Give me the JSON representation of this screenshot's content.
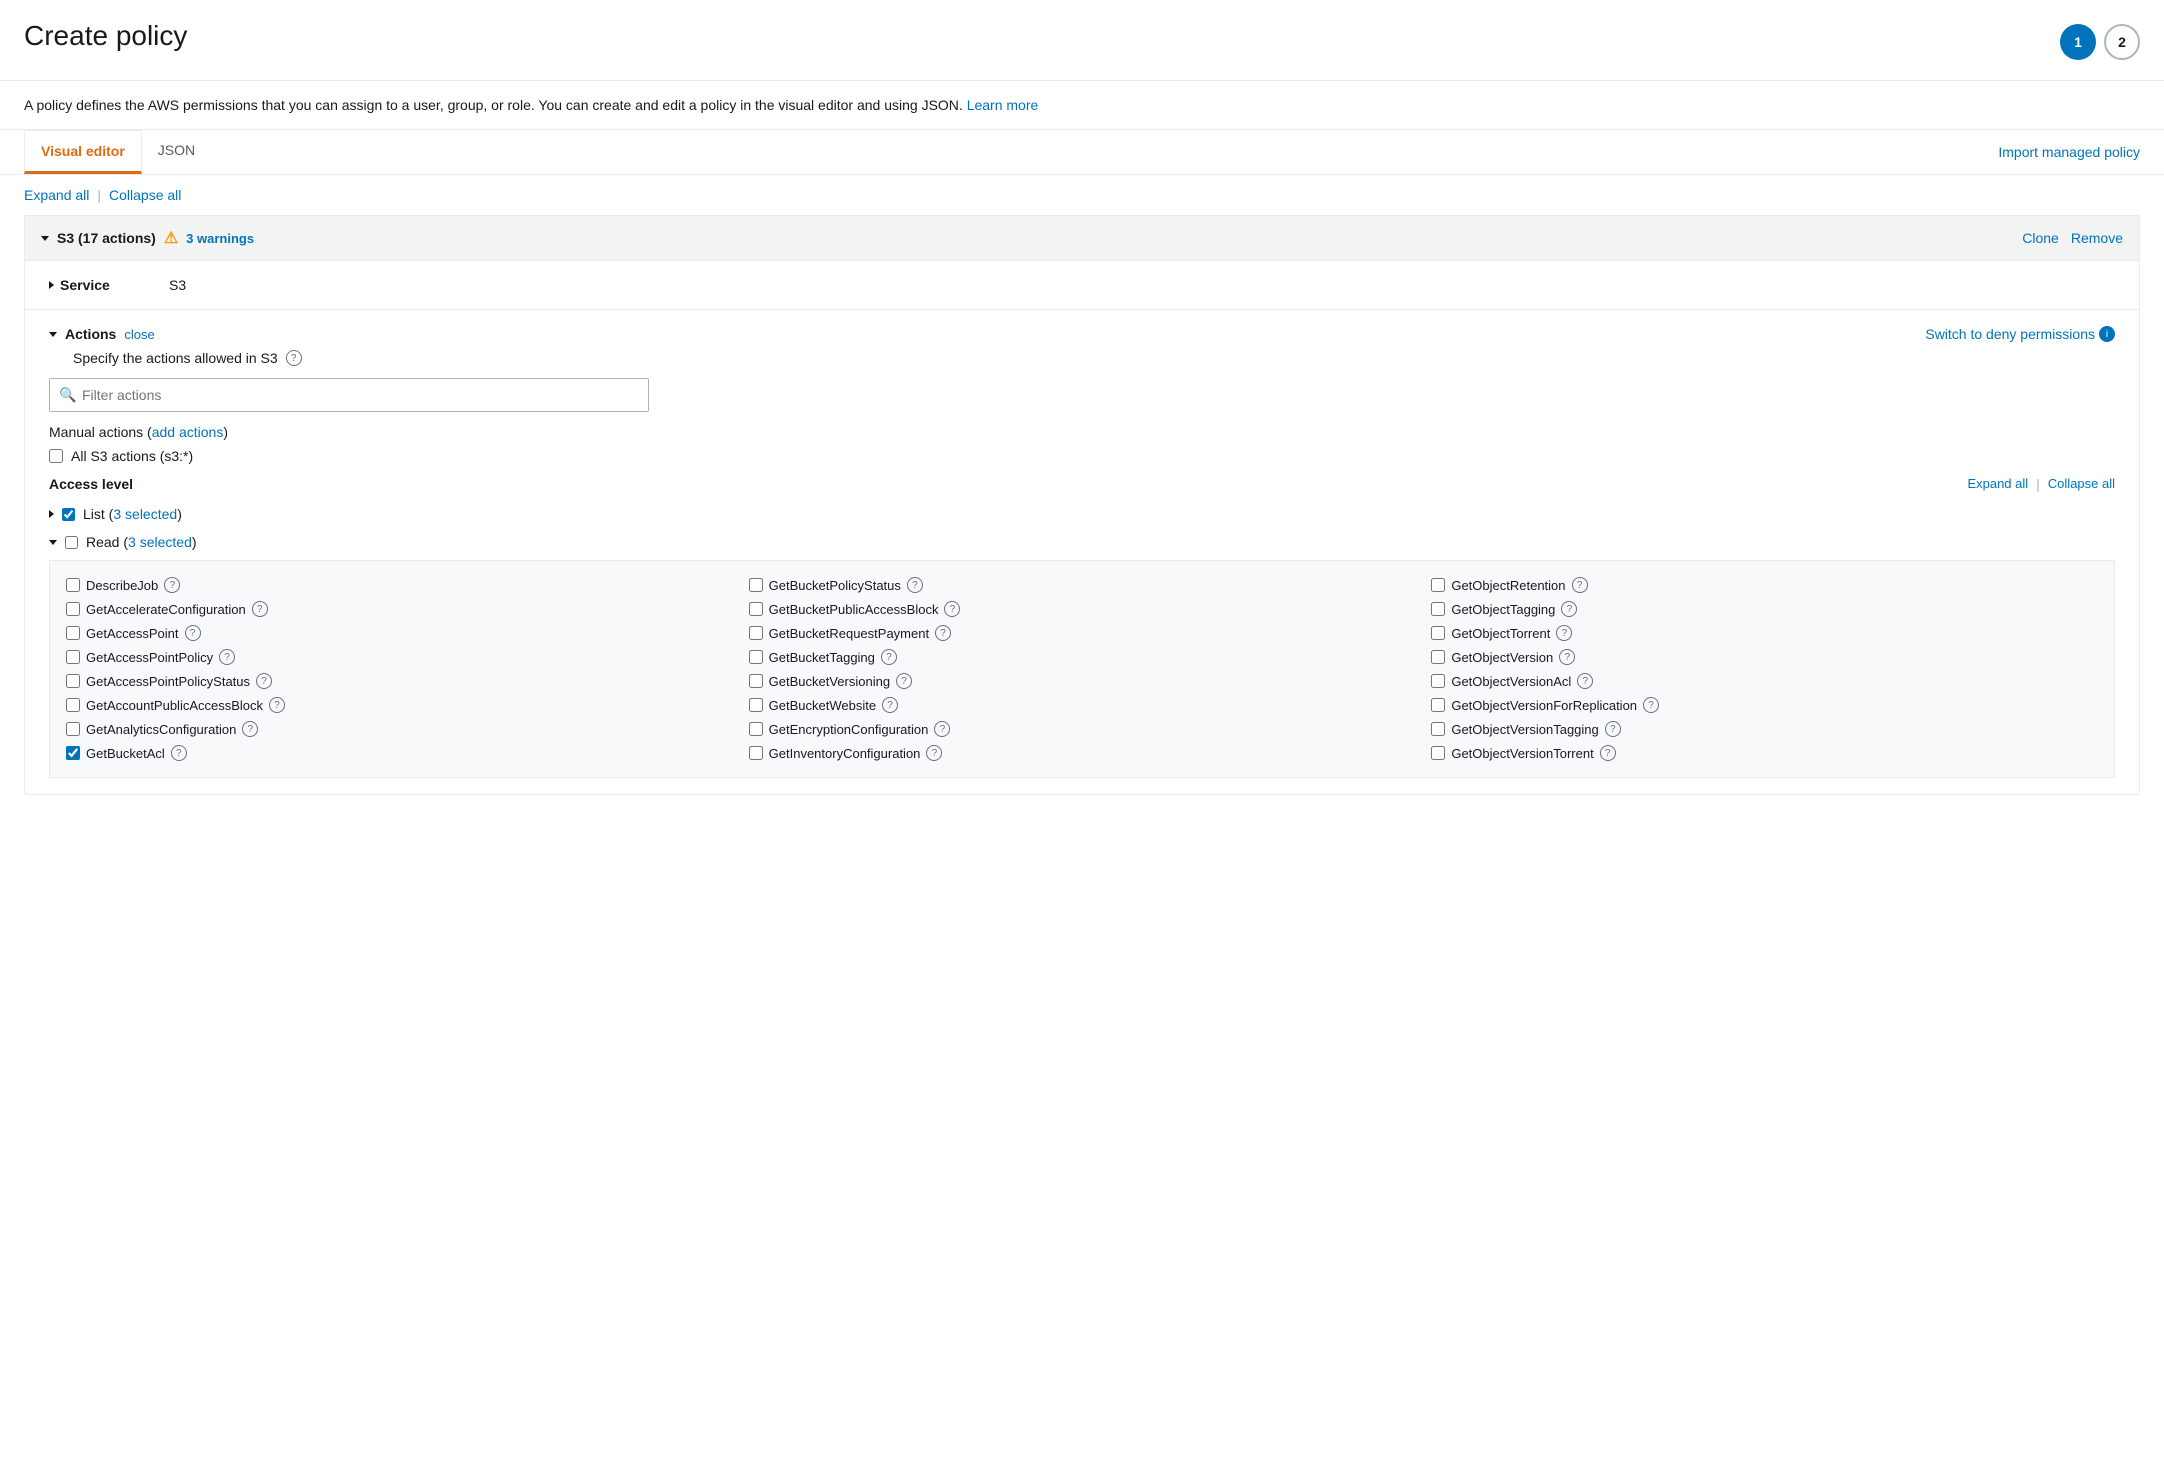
{
  "page": {
    "title": "Create policy",
    "description": "A policy defines the AWS permissions that you can assign to a user, group, or role. You can create and edit a policy in the visual editor and using JSON.",
    "learn_more": "Learn more",
    "import_managed_policy": "Import managed policy"
  },
  "steps": [
    {
      "label": "1",
      "active": true
    },
    {
      "label": "2",
      "active": false
    }
  ],
  "tabs": [
    {
      "label": "Visual editor",
      "active": true
    },
    {
      "label": "JSON",
      "active": false
    }
  ],
  "expand_all": "Expand all",
  "collapse_all": "Collapse all",
  "policy_block": {
    "title": "S3 (17 actions)",
    "warning_count": "3 warnings",
    "clone": "Clone",
    "remove": "Remove"
  },
  "service": {
    "label": "Service",
    "value": "S3"
  },
  "actions": {
    "label": "Actions",
    "close": "close",
    "subtitle": "Specify the actions allowed in S3",
    "switch_deny": "Switch to deny permissions",
    "filter_placeholder": "Filter actions",
    "manual_actions_label": "Manual actions",
    "add_actions": "add actions",
    "all_s3_actions": "All S3 actions (s3:*)",
    "access_level": "Access level",
    "expand_all": "Expand all",
    "collapse_all": "Collapse all",
    "list_item": "List",
    "list_selected": "3 selected",
    "read_item": "Read",
    "read_selected": "3 selected",
    "read_actions": [
      {
        "name": "DescribeJob",
        "checked": false
      },
      {
        "name": "GetBucketPolicyStatus",
        "checked": false
      },
      {
        "name": "GetObjectRetention",
        "checked": false
      },
      {
        "name": "GetAccelerateConfiguration",
        "checked": false
      },
      {
        "name": "GetBucketPublicAccessBlock",
        "checked": false
      },
      {
        "name": "GetObjectTagging",
        "checked": false
      },
      {
        "name": "GetAccessPoint",
        "checked": false
      },
      {
        "name": "GetBucketRequestPayment",
        "checked": false
      },
      {
        "name": "GetObjectTorrent",
        "checked": false
      },
      {
        "name": "GetAccessPointPolicy",
        "checked": false
      },
      {
        "name": "GetBucketTagging",
        "checked": false
      },
      {
        "name": "GetObjectVersion",
        "checked": false
      },
      {
        "name": "GetAccessPointPolicyStatus",
        "checked": false
      },
      {
        "name": "GetBucketVersioning",
        "checked": false
      },
      {
        "name": "GetObjectVersionAcl",
        "checked": false
      },
      {
        "name": "GetAccountPublicAccessBlock",
        "checked": false
      },
      {
        "name": "GetBucketWebsite",
        "checked": false
      },
      {
        "name": "GetObjectVersionForReplication",
        "checked": false
      },
      {
        "name": "GetAnalyticsConfiguration",
        "checked": false
      },
      {
        "name": "GetEncryptionConfiguration",
        "checked": false
      },
      {
        "name": "GetObjectVersionTagging",
        "checked": false
      },
      {
        "name": "GetBucketAcl",
        "checked": true
      },
      {
        "name": "GetInventoryConfiguration",
        "checked": false
      },
      {
        "name": "GetObjectVersionTorrent",
        "checked": false
      }
    ]
  }
}
